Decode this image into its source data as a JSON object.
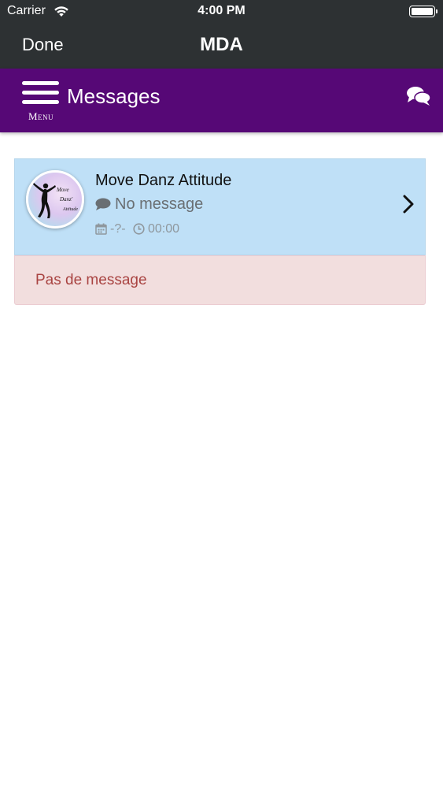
{
  "status_bar": {
    "carrier": "Carrier",
    "time": "4:00 PM"
  },
  "nav": {
    "done_label": "Done",
    "title": "MDA"
  },
  "header": {
    "menu_label": "Menu",
    "title": "Messages",
    "color": "#560876"
  },
  "conversations": [
    {
      "name": "Move Danz Attitude",
      "last_message": "No message",
      "date": "-?-",
      "time": "00:00"
    }
  ],
  "alert": {
    "text": "Pas de message"
  },
  "icons": {
    "wifi": "wifi-icon",
    "battery": "battery-icon",
    "menu": "hamburger-menu-icon",
    "chat": "comments-icon",
    "comment": "comment-icon",
    "calendar": "calendar-icon",
    "clock": "clock-icon",
    "chevron": "chevron-right-icon"
  }
}
